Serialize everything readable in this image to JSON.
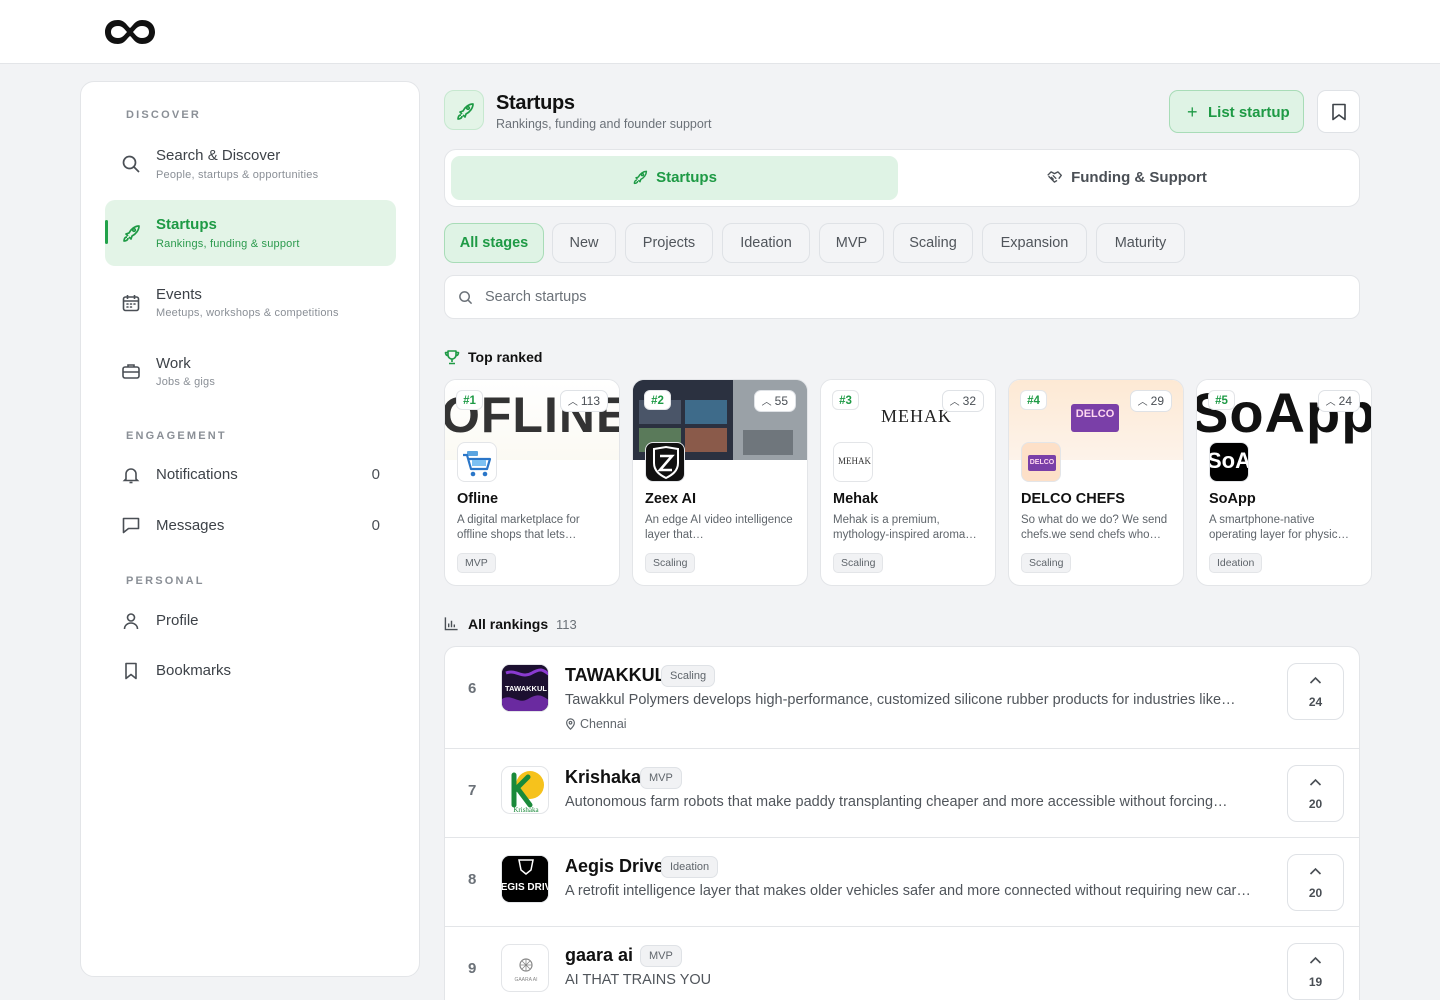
{
  "sidebar": {
    "sections": {
      "discover": "DISCOVER",
      "engagement": "ENGAGEMENT",
      "personal": "PERSONAL"
    },
    "items": [
      {
        "title": "Search & Discover",
        "sub": "People, startups & opportunities",
        "icon": "search-icon"
      },
      {
        "title": "Startups",
        "sub": "Rankings, funding & support",
        "icon": "rocket-icon"
      },
      {
        "title": "Events",
        "sub": "Meetups, workshops & competitions",
        "icon": "calendar-icon"
      },
      {
        "title": "Work",
        "sub": "Jobs & gigs",
        "icon": "briefcase-icon"
      },
      {
        "title": "Notifications",
        "count": "0",
        "icon": "bell-icon"
      },
      {
        "title": "Messages",
        "count": "0",
        "icon": "message-icon"
      },
      {
        "title": "Profile",
        "icon": "user-icon"
      },
      {
        "title": "Bookmarks",
        "icon": "bookmark-icon"
      }
    ]
  },
  "header": {
    "title": "Startups",
    "subtitle": "Rankings, funding and founder support",
    "list_button": "List startup"
  },
  "tabs": [
    {
      "label": "Startups",
      "icon": "rocket-icon"
    },
    {
      "label": "Funding & Support",
      "icon": "handshake-icon"
    }
  ],
  "filters": [
    "All stages",
    "New",
    "Projects",
    "Ideation",
    "MVP",
    "Scaling",
    "Expansion",
    "Maturity"
  ],
  "search": {
    "placeholder": "Search startups"
  },
  "top_ranked": {
    "title": "Top ranked",
    "cards": [
      {
        "rank": "#1",
        "votes": "113",
        "name": "Ofline",
        "desc": "A digital marketplace for offline shops that lets…",
        "stage": "MVP",
        "banner": "OFLINE"
      },
      {
        "rank": "#2",
        "votes": "55",
        "name": "Zeex AI",
        "desc": "An edge AI video intelligence layer that…",
        "stage": "Scaling",
        "banner": ""
      },
      {
        "rank": "#3",
        "votes": "32",
        "name": "Mehak",
        "desc": "Mehak is a premium, mythology-inspired aroma…",
        "stage": "Scaling",
        "banner": "MEHAK"
      },
      {
        "rank": "#4",
        "votes": "29",
        "name": "DELCO CHEFS",
        "desc": "So what do we do? We send chefs.we send chefs who…",
        "stage": "Scaling",
        "banner": "DELCO"
      },
      {
        "rank": "#5",
        "votes": "24",
        "name": "SoApp",
        "desc": "A smartphone-native operating layer for physic…",
        "stage": "Ideation",
        "banner": "SoApp"
      }
    ]
  },
  "all_rankings": {
    "title": "All rankings",
    "count": "113",
    "rows": [
      {
        "rank": "6",
        "name": "TAWAKKUL",
        "stage": "Scaling",
        "desc": "Tawakkul Polymers develops high-performance, customized silicone rubber products for industries like…",
        "location": "Chennai",
        "votes": "24"
      },
      {
        "rank": "7",
        "name": "Krishaka",
        "stage": "MVP",
        "desc": "Autonomous farm robots that make paddy transplanting cheaper and more accessible without forcing…",
        "location": "",
        "votes": "20"
      },
      {
        "rank": "8",
        "name": "Aegis Drive",
        "stage": "Ideation",
        "desc": "A retrofit intelligence layer that makes older vehicles safer and more connected without requiring new car…",
        "location": "",
        "votes": "20"
      },
      {
        "rank": "9",
        "name": "gaara ai",
        "stage": "MVP",
        "desc": "AI THAT TRAINS YOU",
        "location": "",
        "votes": "19"
      }
    ]
  },
  "colors": {
    "accent": "#1e9a45",
    "accent_bg": "#dff3e5"
  }
}
